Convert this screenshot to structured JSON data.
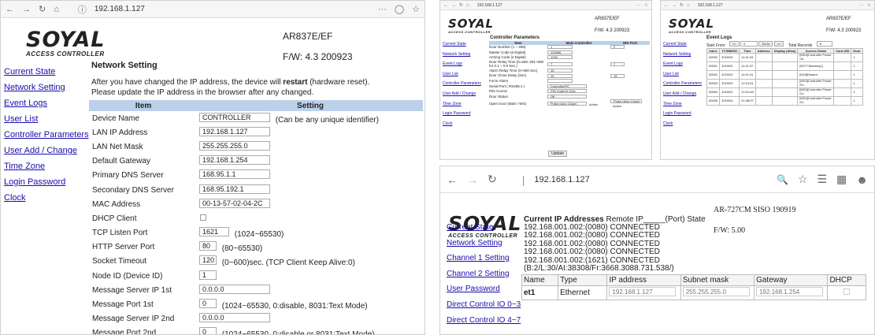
{
  "p1": {
    "url": "192.168.1.127",
    "model": "AR837E/EF",
    "fw": "F/W: 4.3 200923",
    "logo": "SOYAL",
    "logo_sub": "ACCESS CONTROLLER",
    "heading": "Network Setting",
    "info1a": "After you have changed the IP address, the device will ",
    "info1b": "restart",
    "info1c": " (hardware reset).",
    "info2": "Please update the IP address in the browser after any changed.",
    "col_item": "Item",
    "col_setting": "Setting",
    "nav": [
      "Current State",
      "Network Setting",
      "Event Logs",
      "User List",
      "Controller Parameters",
      "User Add / Change",
      "Time Zone",
      "Login Password",
      "Clock"
    ],
    "rows": [
      {
        "label": "Device Name",
        "value": "CONTROLLER",
        "note": "(Can be any unique identifier)",
        "w": 90
      },
      {
        "label": "LAN IP Address",
        "value": "192.168.1.127",
        "note": "",
        "w": 90
      },
      {
        "label": "LAN Net Mask",
        "value": "255.255.255.0",
        "note": "",
        "w": 90
      },
      {
        "label": "Default Gateway",
        "value": "192.168.1.254",
        "note": "",
        "w": 90
      },
      {
        "label": "Primary DNS Server",
        "value": "168.95.1.1",
        "note": "",
        "w": 90
      },
      {
        "label": "Secondary DNS Server",
        "value": "168.95.192.1",
        "note": "",
        "w": 90
      },
      {
        "label": "MAC Address",
        "value": "00-13-57-02-04-2C",
        "note": "",
        "w": 90
      },
      {
        "label": "DHCP Client",
        "value": "",
        "note": "",
        "w": 0,
        "check": true
      },
      {
        "label": "TCP Listen Port",
        "value": "1621",
        "note": "(1024~65530)",
        "w": 38
      },
      {
        "label": "HTTP Server Port",
        "value": "80",
        "note": "(80~65530)",
        "w": 22
      },
      {
        "label": "Socket Timeout",
        "value": "120",
        "note": "(0~600)sec. (TCP Client Keep Alive:0)",
        "w": 22
      },
      {
        "label": "Node ID (Device ID)",
        "value": "1",
        "note": "",
        "w": 22
      },
      {
        "label": "Message Server IP 1st",
        "value": "0.0.0.0",
        "note": "",
        "w": 90
      },
      {
        "label": "Message Port 1st",
        "value": "0",
        "note": "(1024~65530, 0:disable, 8031:Text Mode)",
        "w": 22
      },
      {
        "label": "Message Server IP 2nd",
        "value": "0.0.0.0",
        "note": "",
        "w": 90
      },
      {
        "label": "Message Port 2nd",
        "value": "0",
        "note": "(1024~65530, 0:disable or 8031:Text Mode)",
        "w": 22
      }
    ]
  },
  "p2": {
    "url": "192.168.1.127",
    "model": "AR837E/EF",
    "fw": "F/W: 4.3 200923",
    "logo": "SOYAL",
    "logo_sub": "ACCESS CONTROLLER",
    "heading": "Controller Parameters",
    "col_item": "Item",
    "col_main": "Main Controller",
    "col_wg": "WG Port",
    "update": "Update",
    "nav": [
      "Current State",
      "Network Setting",
      "Event Logs",
      "User List",
      "Controller Parameters",
      "User Add / Change",
      "Time Zone",
      "Login Password",
      "Clock"
    ],
    "rows": [
      {
        "label": "Door Number (1 ~ 255)",
        "v1": "1",
        "v2": "2"
      },
      {
        "label": "Master Code (6 Digital)",
        "v1": "123456",
        "v2": ""
      },
      {
        "label": "Arming Code (4 Digital)",
        "v1": "1234",
        "v2": ""
      },
      {
        "label": "Door Relay Time (0=600; 601~609 for 0.1 ~ 0.9 Sec.)",
        "v1": "7",
        "v2": "7"
      },
      {
        "label": "Alarm Relay Time (0~600 Sec)",
        "v1": "15",
        "v2": ""
      },
      {
        "label": "Door Close Delay (Sec)",
        "v1": "15",
        "v2": "15"
      },
      {
        "label": "Force Alarm",
        "v1": "",
        "v2": ""
      },
      {
        "label": "Serial Port ( RS485-1 )",
        "v1": "Controller/PC",
        "v2": ""
      },
      {
        "label": "PIN Access",
        "v1": "PIN Code(4) Only",
        "v2": ""
      },
      {
        "label": "Door Status",
        "v1": "Off",
        "v2": ""
      },
      {
        "label": "Open Door (Main / WG)",
        "v1": "Pulse (Auto Close)",
        "v2": "Pulse (Auto Close)"
      }
    ],
    "active": "Active"
  },
  "p3": {
    "url": "192.168.1.127",
    "model": "AR837E/EF",
    "fw": "F/W: 4.3 200923",
    "logo": "SOYAL",
    "logo_sub": "ACCESS CONTROLLER",
    "heading": "Event Logs",
    "start_from": "Start From",
    "start_val": "0",
    "go_btn": "Go to",
    "prev_btn": "<<",
    "next_btn": ">>",
    "total_label": "Total Records",
    "total_val": "6",
    "nav": [
      "Current State",
      "Network Setting",
      "Event Logs",
      "User List",
      "Controller Parameters",
      "User Add / Change",
      "Time Zone",
      "Login Password",
      "Clock"
    ],
    "cols": [
      "Index",
      "YY/MM/DD",
      "Time",
      "Address",
      "Display (Alias)",
      "Access Detail",
      "Card UID",
      "Door"
    ],
    "rows": [
      [
        "00000",
        "2019/02",
        "11:41:33",
        "",
        "",
        "[MD4]Controller Power On",
        "",
        "1"
      ],
      [
        "00001",
        "2019/02",
        "11:41:37",
        "",
        "",
        "[M7/7\"Alarming\"]",
        "",
        "1"
      ],
      [
        "00002",
        "2019/02",
        "11:41:41",
        "",
        "",
        "[M15]Disarm",
        "",
        "1"
      ],
      [
        "00003",
        "2019/02",
        "12:10:51",
        "",
        "",
        "[MD4]Controller Power On",
        "",
        "1"
      ],
      [
        "00004",
        "2019/02",
        "12:31:48",
        "",
        "",
        "[MD4]Controller Power On",
        "",
        "1"
      ],
      [
        "00005",
        "2019/04",
        "21:48:07",
        "",
        "",
        "[MD4]Controller Power On",
        "",
        "1"
      ]
    ]
  },
  "p4": {
    "url": "192.168.1.127",
    "model": "AR-727CM SISO 190919",
    "fw": "F/W: 5.00",
    "logo": "SOYAL",
    "logo_sub": "ACCESS CONTROLLER",
    "heading_bold": "Current IP Addresses",
    "heading_rest": " Remote IP_____(Port) State",
    "lines": [
      "192.168.001.002:(0080) CONNECTED",
      "192.168.001.002:(0080) CONNECTED",
      "192.168.001.002:(0080) CONNECTED",
      "192.168.001.002:(0080) CONNECTED",
      "192.168.001.002:(1621) CONNECTED",
      "(B:2/L:30/AI:38308/Fr:3668.3088.731.538/)"
    ],
    "nav": [
      "Current State",
      "Network Setting",
      "Channel 1 Setting",
      "Channel 2 Setting",
      "User Password",
      "Direct Control IO 0~3",
      "Direct Control IO 4~7"
    ],
    "cols": [
      "Name",
      "Type",
      "IP address",
      "Subnet mask",
      "Gateway",
      "DHCP"
    ],
    "row": {
      "name": "et1",
      "type": "Ethernet",
      "ip": "192.168.1.127",
      "mask": "255.255.255.0",
      "gw": "192.168.1.254"
    }
  }
}
